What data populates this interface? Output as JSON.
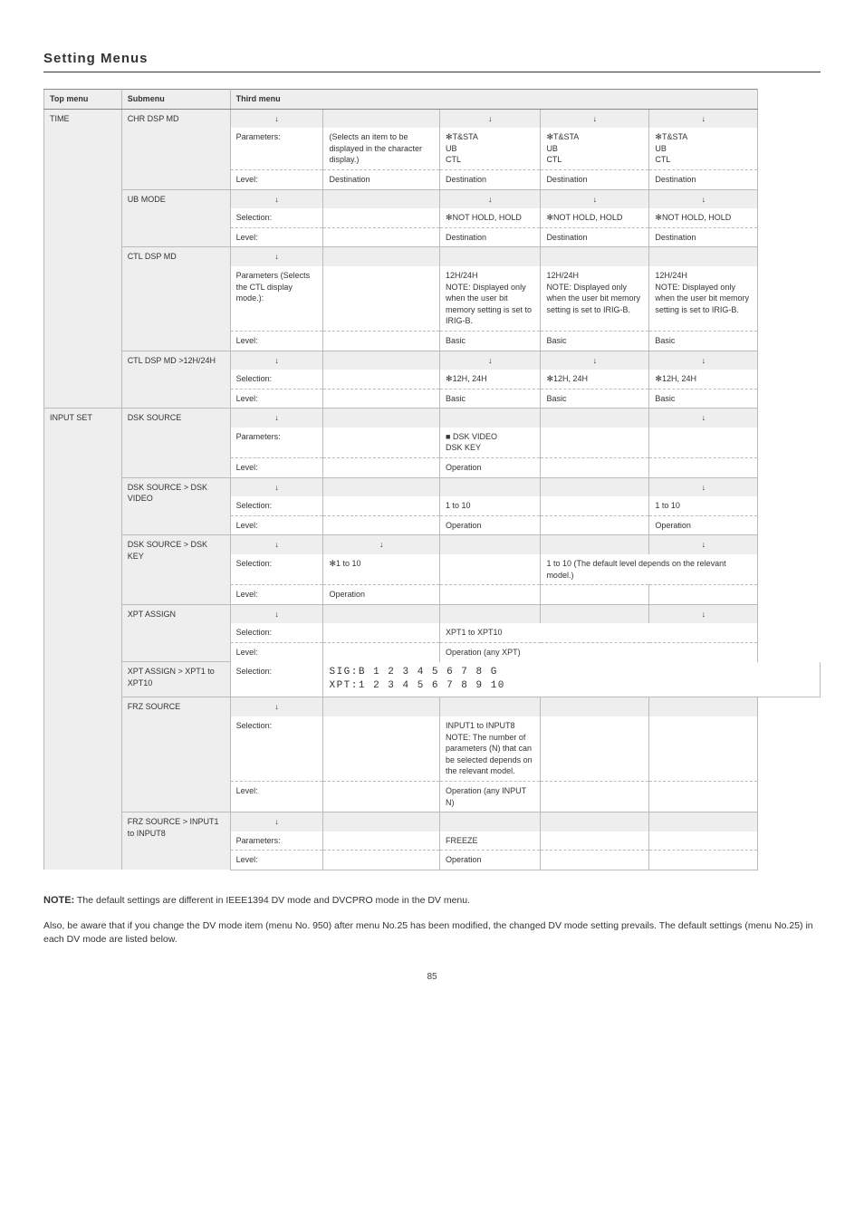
{
  "page_title": "Setting Menus",
  "headers": {
    "top": "Top menu",
    "sub": "Submenu",
    "third": "Third menu"
  },
  "sections": [
    {
      "top": "TIME",
      "groups": [
        {
          "sub": "CHR DSP MD",
          "rows": [
            {
              "type": "param",
              "cells": [
                "↓",
                "",
                "↓",
                "↓",
                "↓"
              ]
            },
            {
              "type": "level",
              "cells": [
                "Parameters:",
                "(Selects an item to be displayed in the character display.)",
                "✻T&STA<br>UB<br>CTL",
                "✻T&STA<br>UB<br>CTL",
                "✻T&STA<br>UB<br>CTL"
              ],
              "dash": true
            },
            {
              "type": "level",
              "cells": [
                "Level:",
                "Destination",
                "Destination",
                "Destination",
                "Destination"
              ]
            }
          ]
        },
        {
          "sub": "UB MODE",
          "rows": [
            {
              "type": "param",
              "cells": [
                "↓",
                "",
                "↓",
                "↓",
                "↓"
              ]
            },
            {
              "type": "level",
              "cells": [
                "Selection:",
                "",
                "✻NOT HOLD, HOLD",
                "✻NOT HOLD, HOLD",
                "✻NOT HOLD, HOLD"
              ],
              "dash": true
            },
            {
              "type": "level",
              "cells": [
                "Level:",
                "",
                "Destination",
                "Destination",
                "Destination"
              ]
            }
          ]
        },
        {
          "sub": "CTL DSP MD",
          "rows": [
            {
              "type": "param",
              "cells": [
                "↓",
                "",
                "",
                "",
                ""
              ]
            },
            {
              "type": "level",
              "cells": [
                "Parameters (Selects the CTL display mode.):",
                "",
                "12H/24H<br>NOTE: Displayed only when the user bit memory setting is set to IRIG-B.",
                "12H/24H<br>NOTE: Displayed only when the user bit memory setting is set to IRIG-B.",
                "12H/24H<br>NOTE: Displayed only when the user bit memory setting is set to IRIG-B."
              ],
              "dash": true
            },
            {
              "type": "level",
              "cells": [
                "Level:",
                "",
                "Basic",
                "Basic",
                "Basic"
              ]
            }
          ]
        },
        {
          "sub": "CTL DSP MD >12H/24H",
          "rows": [
            {
              "type": "param",
              "cells": [
                "↓",
                "",
                "↓",
                "↓",
                "↓"
              ]
            },
            {
              "type": "level",
              "cells": [
                "Selection:",
                "",
                "✻12H, 24H",
                "✻12H, 24H",
                "✻12H, 24H"
              ],
              "dash": true
            },
            {
              "type": "level",
              "cells": [
                "Level:",
                "",
                "Basic",
                "Basic",
                "Basic"
              ]
            }
          ]
        }
      ]
    },
    {
      "top": "INPUT SET",
      "groups": [
        {
          "sub": "DSK SOURCE",
          "rows": [
            {
              "type": "param",
              "cells": [
                "↓",
                "",
                "",
                "",
                "↓"
              ]
            },
            {
              "type": "level",
              "cells": [
                "Parameters:",
                "",
                "■ DSK VIDEO<br>DSK KEY",
                "",
                ""
              ],
              "dash": true
            },
            {
              "type": "level",
              "cells": [
                "Level:",
                "",
                "Operation",
                "",
                ""
              ]
            }
          ]
        },
        {
          "sub": "DSK SOURCE > DSK VIDEO",
          "rows": [
            {
              "type": "param",
              "cells": [
                "↓",
                "",
                "",
                "",
                "↓"
              ]
            },
            {
              "type": "level",
              "cells": [
                "Selection:",
                "",
                "1 to 10",
                "",
                "1 to 10"
              ],
              "dash": true
            },
            {
              "type": "level",
              "cells": [
                "Level:",
                "",
                "Operation",
                "",
                "Operation"
              ]
            }
          ]
        },
        {
          "sub": "DSK SOURCE > DSK KEY",
          "rows": [
            {
              "type": "param",
              "cells": [
                "↓",
                "↓",
                "",
                "",
                "↓"
              ]
            },
            {
              "type": "level",
              "cells": [
                "Selection:",
                "✻1 to 10",
                "",
                {
                  "colspan": 2,
                  "text": "1 to 10 (The default level depends on the relevant model.)"
                },
                ""
              ],
              "dash": true
            },
            {
              "type": "level",
              "cells": [
                "Level:",
                "Operation",
                "",
                "",
                ""
              ]
            }
          ]
        },
        {
          "sub": "XPT ASSIGN",
          "rows": [
            {
              "type": "param",
              "cells": [
                "↓",
                "",
                "",
                "",
                "↓"
              ]
            },
            {
              "type": "level",
              "cells": [
                "Selection:",
                "",
                {
                  "colspan": 3,
                  "text": "XPT1 to XPT10"
                },
                ""
              ],
              "dash": true
            },
            {
              "type": "level",
              "cells": [
                "Level:",
                "",
                {
                  "colspan": 3,
                  "text": "Operation (any XPT)"
                },
                ""
              ]
            }
          ]
        },
        {
          "sub": "XPT ASSIGN > XPT1 to XPT10",
          "rows": [
            {
              "type": "level",
              "cells": [
                "Selection:",
                {
                  "colspan": 5,
                  "mono": "SIG:B 1 2 3 4 5 6 7 8 G\nXPT:1 2 3 4 5 6 7 8 9 10"
                }
              ]
            }
          ],
          "solid_b": true
        },
        {
          "sub": "FRZ SOURCE",
          "rows": [
            {
              "type": "param",
              "cells": [
                "↓",
                "",
                "",
                "",
                ""
              ]
            },
            {
              "type": "level",
              "cells": [
                "Selection:",
                "",
                "INPUT1 to INPUT8<br>NOTE: The number of parameters (N) that can be selected depends on the relevant model.",
                "",
                ""
              ],
              "dash": true
            },
            {
              "type": "level",
              "cells": [
                "Level:",
                "",
                "Operation (any INPUT N)",
                "",
                ""
              ],
              "solid_b": true
            }
          ]
        },
        {
          "sub": "FRZ SOURCE > INPUT1 to INPUT8",
          "rows": [
            {
              "type": "param",
              "cells": [
                "↓",
                "",
                "",
                "",
                ""
              ]
            },
            {
              "type": "level",
              "cells": [
                "Parameters:",
                "",
                "FREEZE",
                "",
                ""
              ],
              "dash": true
            },
            {
              "type": "level",
              "cells": [
                "Level:",
                "",
                "Operation",
                "",
                ""
              ]
            }
          ]
        }
      ]
    }
  ],
  "notes": [
    {
      "label": "NOTE:",
      "text": "The default settings are different in IEEE1394 DV mode and DVCPRO mode in the DV menu."
    },
    {
      "text": "Also, be aware that if you change the DV mode item (menu No. 950) after menu No.25 has been modified, the changed DV mode setting prevails. The default settings (menu No.25) in each DV mode are listed below."
    }
  ],
  "page_number": "85"
}
